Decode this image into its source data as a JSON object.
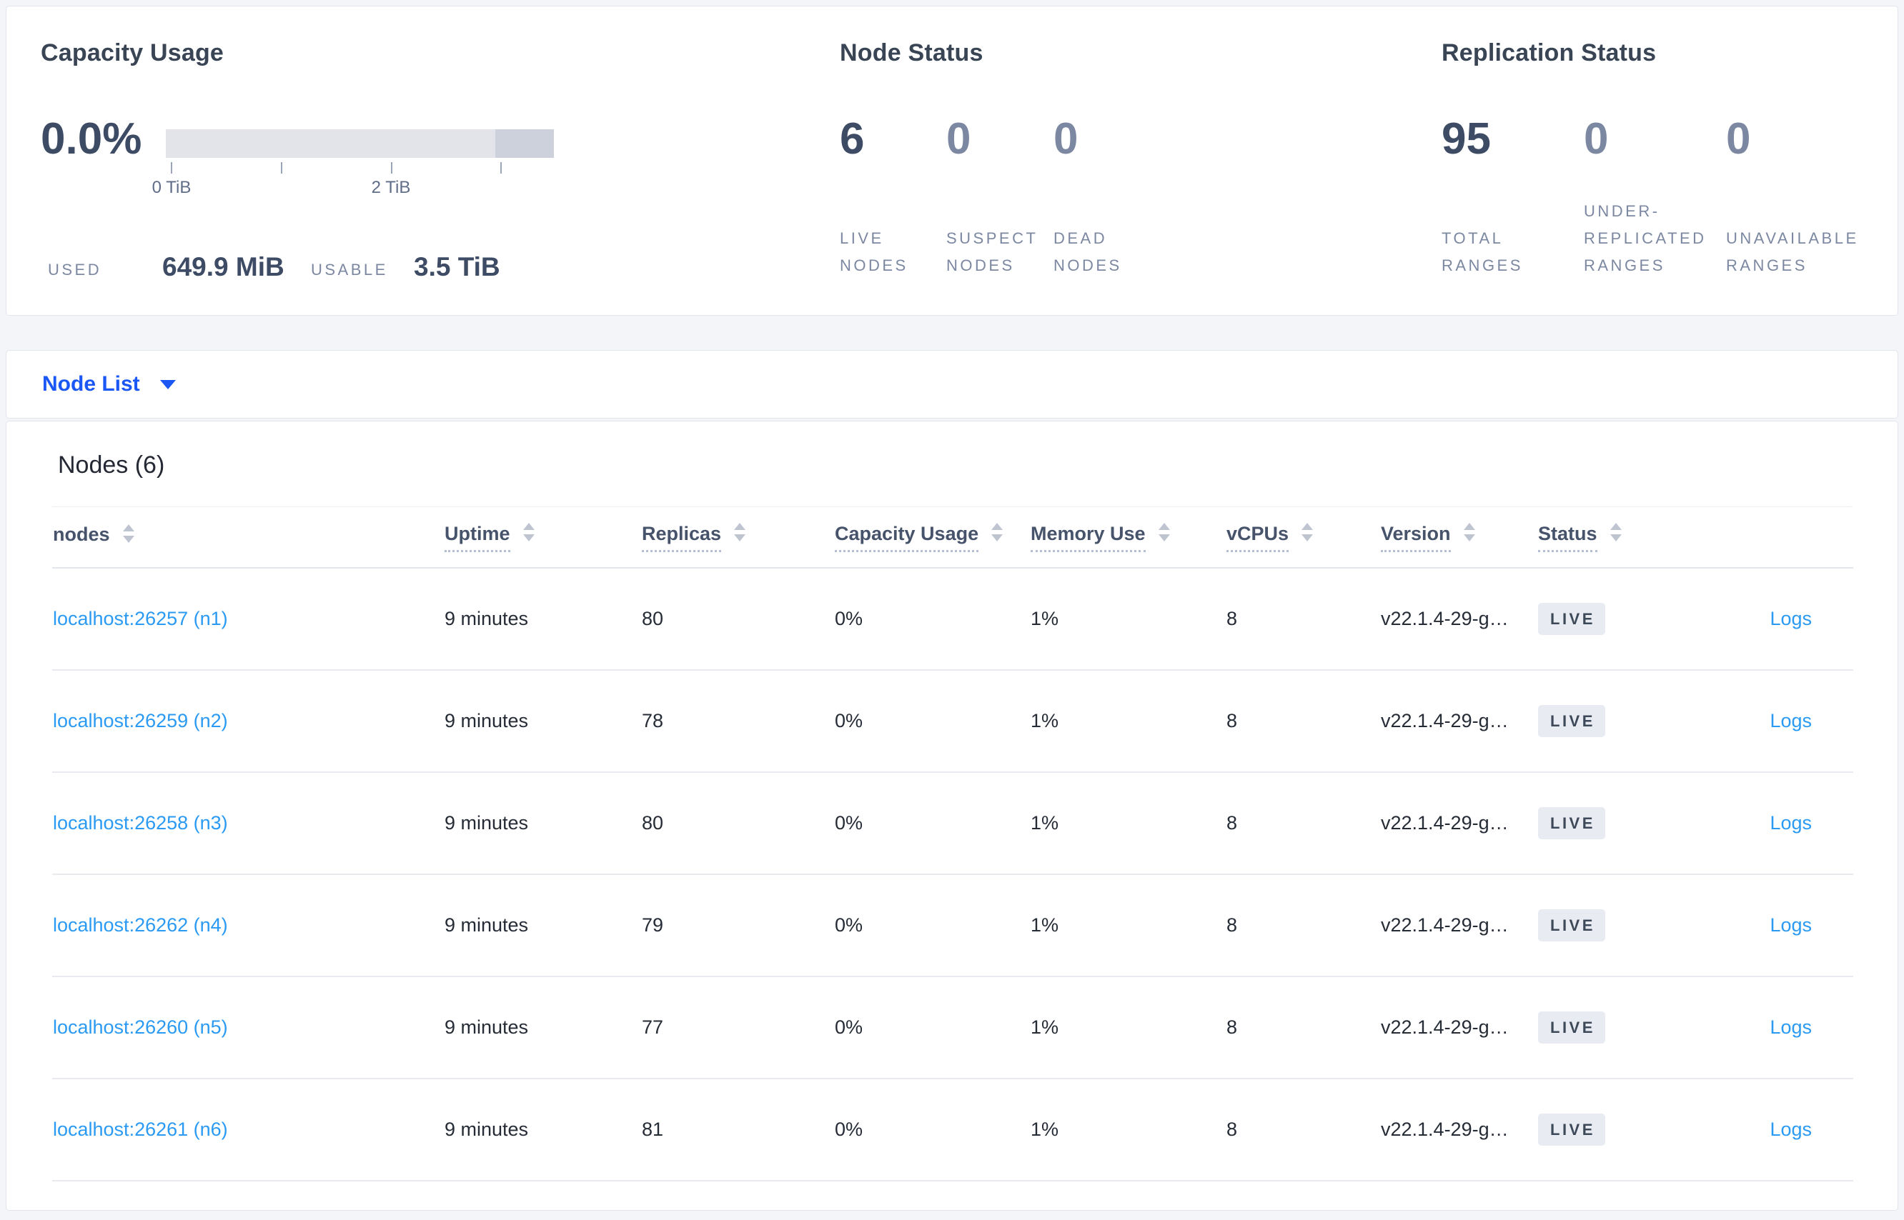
{
  "overview": {
    "capacity": {
      "title": "Capacity Usage",
      "percent": "0.0%",
      "tick_labels": [
        "0 TiB",
        "2 TiB"
      ],
      "used_label": "USED",
      "used_value": "649.9 MiB",
      "usable_label": "USABLE",
      "usable_value": "3.5 TiB"
    },
    "node_status": {
      "title": "Node Status",
      "stats": [
        {
          "value": "6",
          "label": "LIVE NODES"
        },
        {
          "value": "0",
          "label": "SUSPECT NODES"
        },
        {
          "value": "0",
          "label": "DEAD NODES"
        }
      ]
    },
    "replication": {
      "title": "Replication Status",
      "stats": [
        {
          "value": "95",
          "label": "TOTAL RANGES"
        },
        {
          "value": "0",
          "label": "UNDER-REPLICATED RANGES"
        },
        {
          "value": "0",
          "label": "UNAVAILABLE RANGES"
        }
      ]
    }
  },
  "view_selector": {
    "label": "Node List"
  },
  "table": {
    "title": "Nodes (6)",
    "columns": [
      {
        "label": "nodes"
      },
      {
        "label": "Uptime"
      },
      {
        "label": "Replicas"
      },
      {
        "label": "Capacity Usage"
      },
      {
        "label": "Memory Use"
      },
      {
        "label": "vCPUs"
      },
      {
        "label": "Version"
      },
      {
        "label": "Status"
      },
      {
        "label": ""
      }
    ],
    "rows": [
      {
        "node": "localhost:26257 (n1)",
        "uptime": "9 minutes",
        "replicas": "80",
        "capacity": "0%",
        "memory": "1%",
        "vcpus": "8",
        "version": "v22.1.4-29-g…",
        "status": "LIVE",
        "logs": "Logs"
      },
      {
        "node": "localhost:26259 (n2)",
        "uptime": "9 minutes",
        "replicas": "78",
        "capacity": "0%",
        "memory": "1%",
        "vcpus": "8",
        "version": "v22.1.4-29-g…",
        "status": "LIVE",
        "logs": "Logs"
      },
      {
        "node": "localhost:26258 (n3)",
        "uptime": "9 minutes",
        "replicas": "80",
        "capacity": "0%",
        "memory": "1%",
        "vcpus": "8",
        "version": "v22.1.4-29-g…",
        "status": "LIVE",
        "logs": "Logs"
      },
      {
        "node": "localhost:26262 (n4)",
        "uptime": "9 minutes",
        "replicas": "79",
        "capacity": "0%",
        "memory": "1%",
        "vcpus": "8",
        "version": "v22.1.4-29-g…",
        "status": "LIVE",
        "logs": "Logs"
      },
      {
        "node": "localhost:26260 (n5)",
        "uptime": "9 minutes",
        "replicas": "77",
        "capacity": "0%",
        "memory": "1%",
        "vcpus": "8",
        "version": "v22.1.4-29-g…",
        "status": "LIVE",
        "logs": "Logs"
      },
      {
        "node": "localhost:26261 (n6)",
        "uptime": "9 minutes",
        "replicas": "81",
        "capacity": "0%",
        "memory": "1%",
        "vcpus": "8",
        "version": "v22.1.4-29-g…",
        "status": "LIVE",
        "logs": "Logs"
      }
    ]
  }
}
